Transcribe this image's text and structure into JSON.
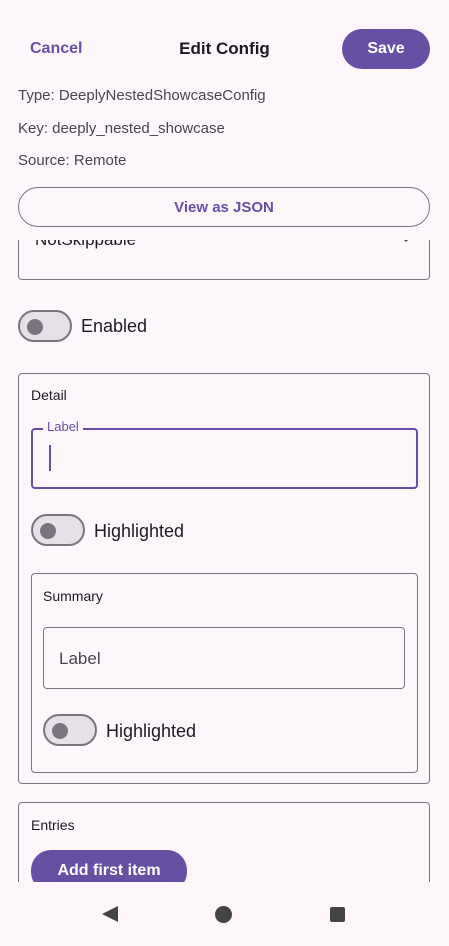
{
  "header": {
    "cancel_label": "Cancel",
    "title": "Edit Config",
    "save_label": "Save"
  },
  "meta": {
    "type": "Type: DeeplyNestedShowcaseConfig",
    "key": "Key: deeply_nested_showcase",
    "source": "Source: Remote"
  },
  "view_json_label": "View as JSON",
  "form": {
    "dropdown_value": "NotSkippable",
    "enabled_label": "Enabled",
    "enabled_on": false,
    "detail": {
      "title": "Detail",
      "label_field_label": "Label",
      "label_value": "",
      "highlighted_label": "Highlighted",
      "highlighted_on": false,
      "summary": {
        "title": "Summary",
        "label_placeholder": "Label",
        "highlighted_label": "Highlighted",
        "highlighted_on": false
      }
    },
    "entries": {
      "title": "Entries",
      "add_label": "Add first item"
    }
  },
  "colors": {
    "accent": "#6750a4",
    "background": "#fdf7fc",
    "outline": "#79747e"
  },
  "icons": {
    "dropdown": "chevron-down-icon",
    "nav_back": "back-triangle-icon",
    "nav_home": "home-circle-icon",
    "nav_recent": "recent-square-icon"
  }
}
